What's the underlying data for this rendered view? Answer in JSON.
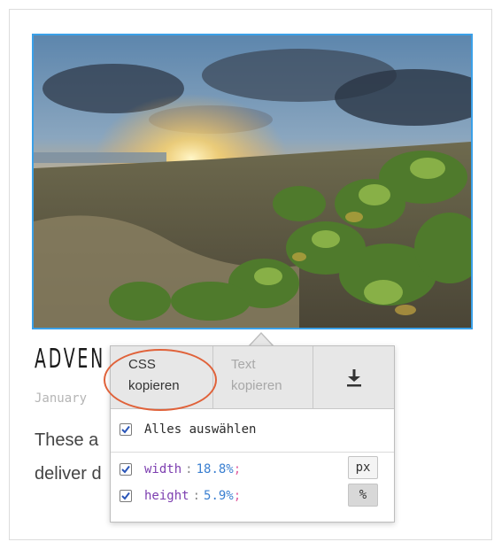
{
  "post": {
    "title": "ADVEN",
    "date": "January",
    "excerpt_line1": "These a",
    "excerpt_line2": "deliver d"
  },
  "popup": {
    "toolbar": {
      "css_copy_line1": "CSS",
      "css_copy_line2": "kopieren",
      "text_copy_line1": "Text",
      "text_copy_line2": "kopieren",
      "download_icon": "download-icon"
    },
    "select_all_label": "Alles auswählen",
    "select_all_checked": true,
    "properties": [
      {
        "name": "width",
        "value": "18.8%",
        "checked": true
      },
      {
        "name": "height",
        "value": "5.9%",
        "checked": true
      }
    ],
    "units": {
      "px_label": "px",
      "percent_label": "%",
      "active": "%"
    }
  },
  "colors": {
    "photo_border": "#3aa0e8",
    "highlight_ring": "#e0623a",
    "property_name": "#7d3fb0",
    "property_value": "#3a7fd0",
    "semicolon": "#e060a0"
  }
}
